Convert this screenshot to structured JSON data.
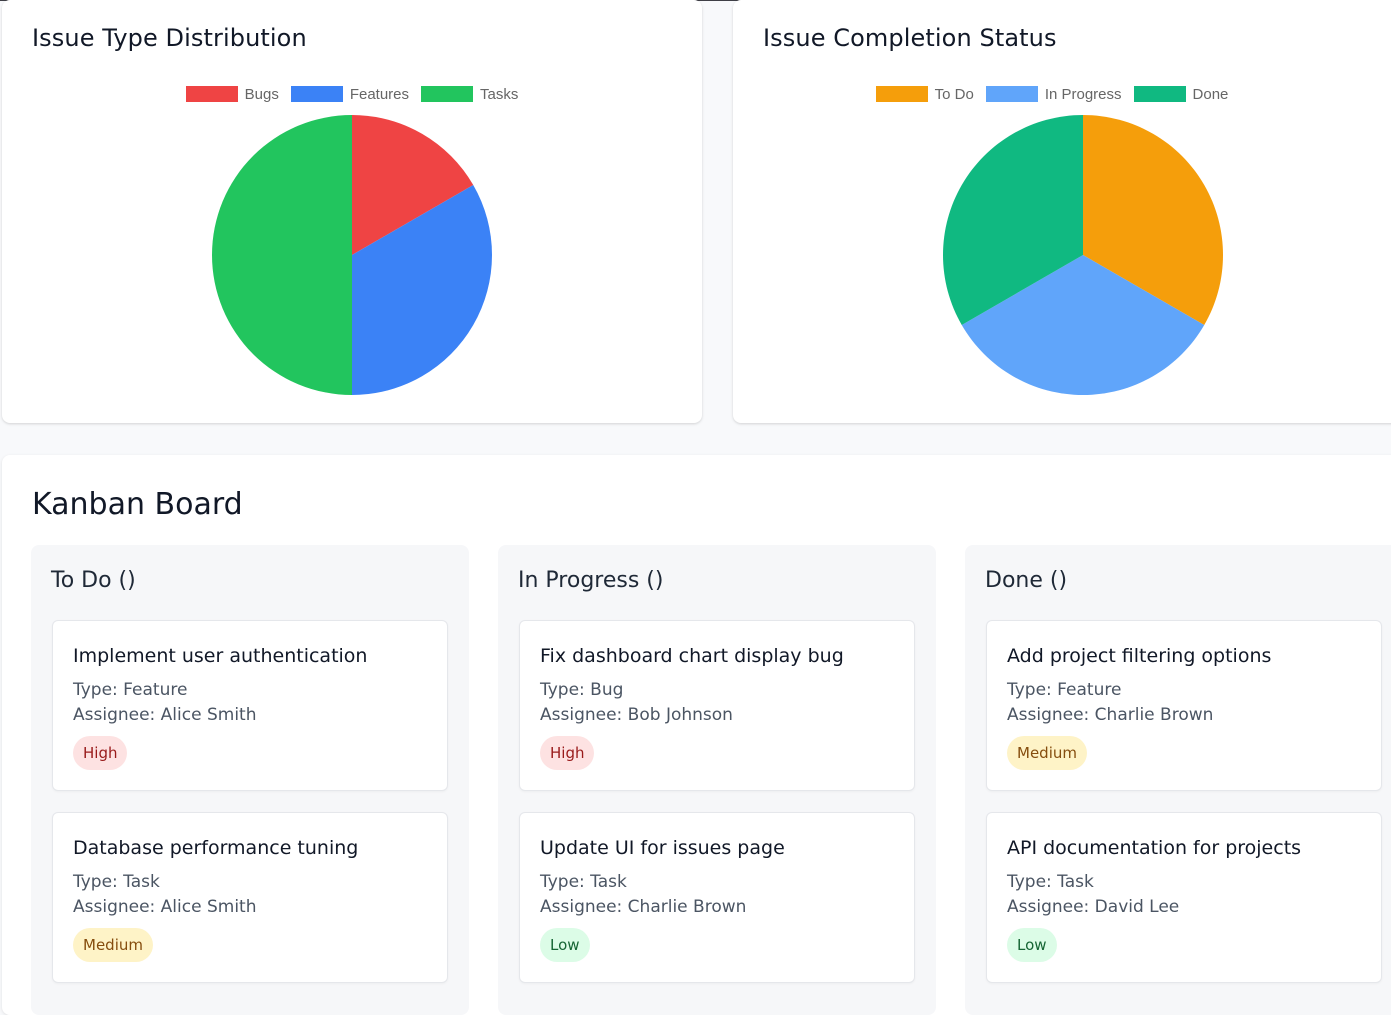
{
  "charts": [
    {
      "title": "Issue Type Distribution",
      "chart_data": {
        "type": "pie",
        "title": "Issue Type Distribution",
        "legend_position": "top",
        "slices": [
          {
            "label": "Bugs",
            "value": 1,
            "color": "#ef4444"
          },
          {
            "label": "Features",
            "value": 2,
            "color": "#3b82f6"
          },
          {
            "label": "Tasks",
            "value": 3,
            "color": "#22c55e"
          }
        ]
      }
    },
    {
      "title": "Issue Completion Status",
      "chart_data": {
        "type": "pie",
        "title": "Issue Completion Status",
        "legend_position": "top",
        "slices": [
          {
            "label": "To Do",
            "value": 2,
            "color": "#f59e0b"
          },
          {
            "label": "In Progress",
            "value": 2,
            "color": "#60a5fa"
          },
          {
            "label": "Done",
            "value": 2,
            "color": "#10b981"
          }
        ]
      }
    }
  ],
  "kanban": {
    "title": "Kanban Board",
    "columns": [
      {
        "title": "To Do ()",
        "issues": [
          {
            "title": "Implement user authentication",
            "type": "Type: Feature",
            "assignee": "Assignee: Alice Smith",
            "priority": "High",
            "priority_level": "high"
          },
          {
            "title": "Database performance tuning",
            "type": "Type: Task",
            "assignee": "Assignee: Alice Smith",
            "priority": "Medium",
            "priority_level": "medium"
          }
        ]
      },
      {
        "title": "In Progress ()",
        "issues": [
          {
            "title": "Fix dashboard chart display bug",
            "type": "Type: Bug",
            "assignee": "Assignee: Bob Johnson",
            "priority": "High",
            "priority_level": "high"
          },
          {
            "title": "Update UI for issues page",
            "type": "Type: Task",
            "assignee": "Assignee: Charlie Brown",
            "priority": "Low",
            "priority_level": "low"
          }
        ]
      },
      {
        "title": "Done ()",
        "issues": [
          {
            "title": "Add project filtering options",
            "type": "Type: Feature",
            "assignee": "Assignee: Charlie Brown",
            "priority": "Medium",
            "priority_level": "medium"
          },
          {
            "title": "API documentation for projects",
            "type": "Type: Task",
            "assignee": "Assignee: David Lee",
            "priority": "Low",
            "priority_level": "low"
          }
        ]
      }
    ]
  }
}
